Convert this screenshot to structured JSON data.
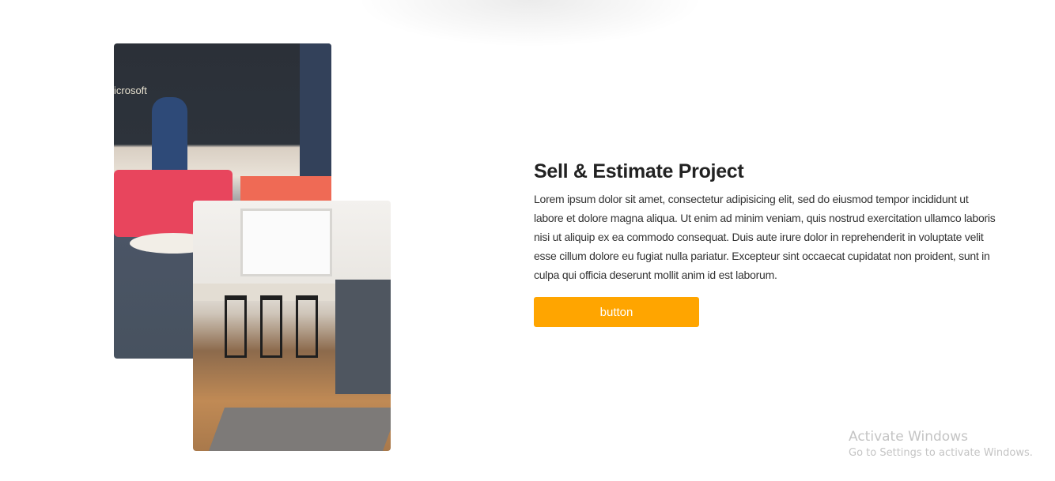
{
  "images": {
    "office": {
      "logo_text": "icrosoft"
    },
    "dining": {}
  },
  "section": {
    "title": "Sell & Estimate Project",
    "body": "Lorem ipsum dolor sit amet, consectetur adipisicing elit, sed do eiusmod tempor incididunt ut labore et dolore magna aliqua. Ut enim ad minim veniam, quis nostrud exercitation ullamco laboris nisi ut aliquip ex ea commodo consequat. Duis aute irure dolor in reprehenderit in voluptate velit esse cillum dolore eu fugiat nulla pariatur. Excepteur sint occaecat cupidatat non proident, sunt in culpa qui officia deserunt mollit anim id est laborum.",
    "button_label": "button",
    "accent_color": "#ffa500"
  },
  "watermark": {
    "title": "Activate Windows",
    "subtitle": "Go to Settings to activate Windows."
  }
}
